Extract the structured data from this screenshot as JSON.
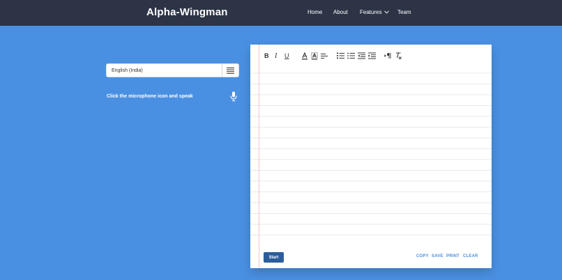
{
  "brand": "Alpha-Wingman",
  "nav": {
    "home": "Home",
    "about": "About",
    "features": "Features",
    "team": "Team"
  },
  "language": {
    "selected": "English (India)"
  },
  "instruction": "Click the microphone icon and speak",
  "editor": {
    "toolbar": {
      "bold": "B",
      "italic": "I",
      "underline": "U"
    },
    "content": ""
  },
  "buttons": {
    "start": "Start",
    "copy": "COPY",
    "save": "SAVE",
    "print": "PRINT",
    "clear": "CLEAR"
  },
  "colors": {
    "navbar": "#2c3446",
    "background": "#4a90e2",
    "start_button": "#2c5d9b",
    "action_link": "#4a90e2"
  },
  "icons": [
    "chevron-down-icon",
    "list-menu-icon",
    "microphone-icon",
    "font-color-icon",
    "background-color-icon",
    "align-icon",
    "ordered-list-icon",
    "bullet-list-icon",
    "outdent-icon",
    "indent-icon",
    "text-direction-icon",
    "clear-format-icon"
  ]
}
